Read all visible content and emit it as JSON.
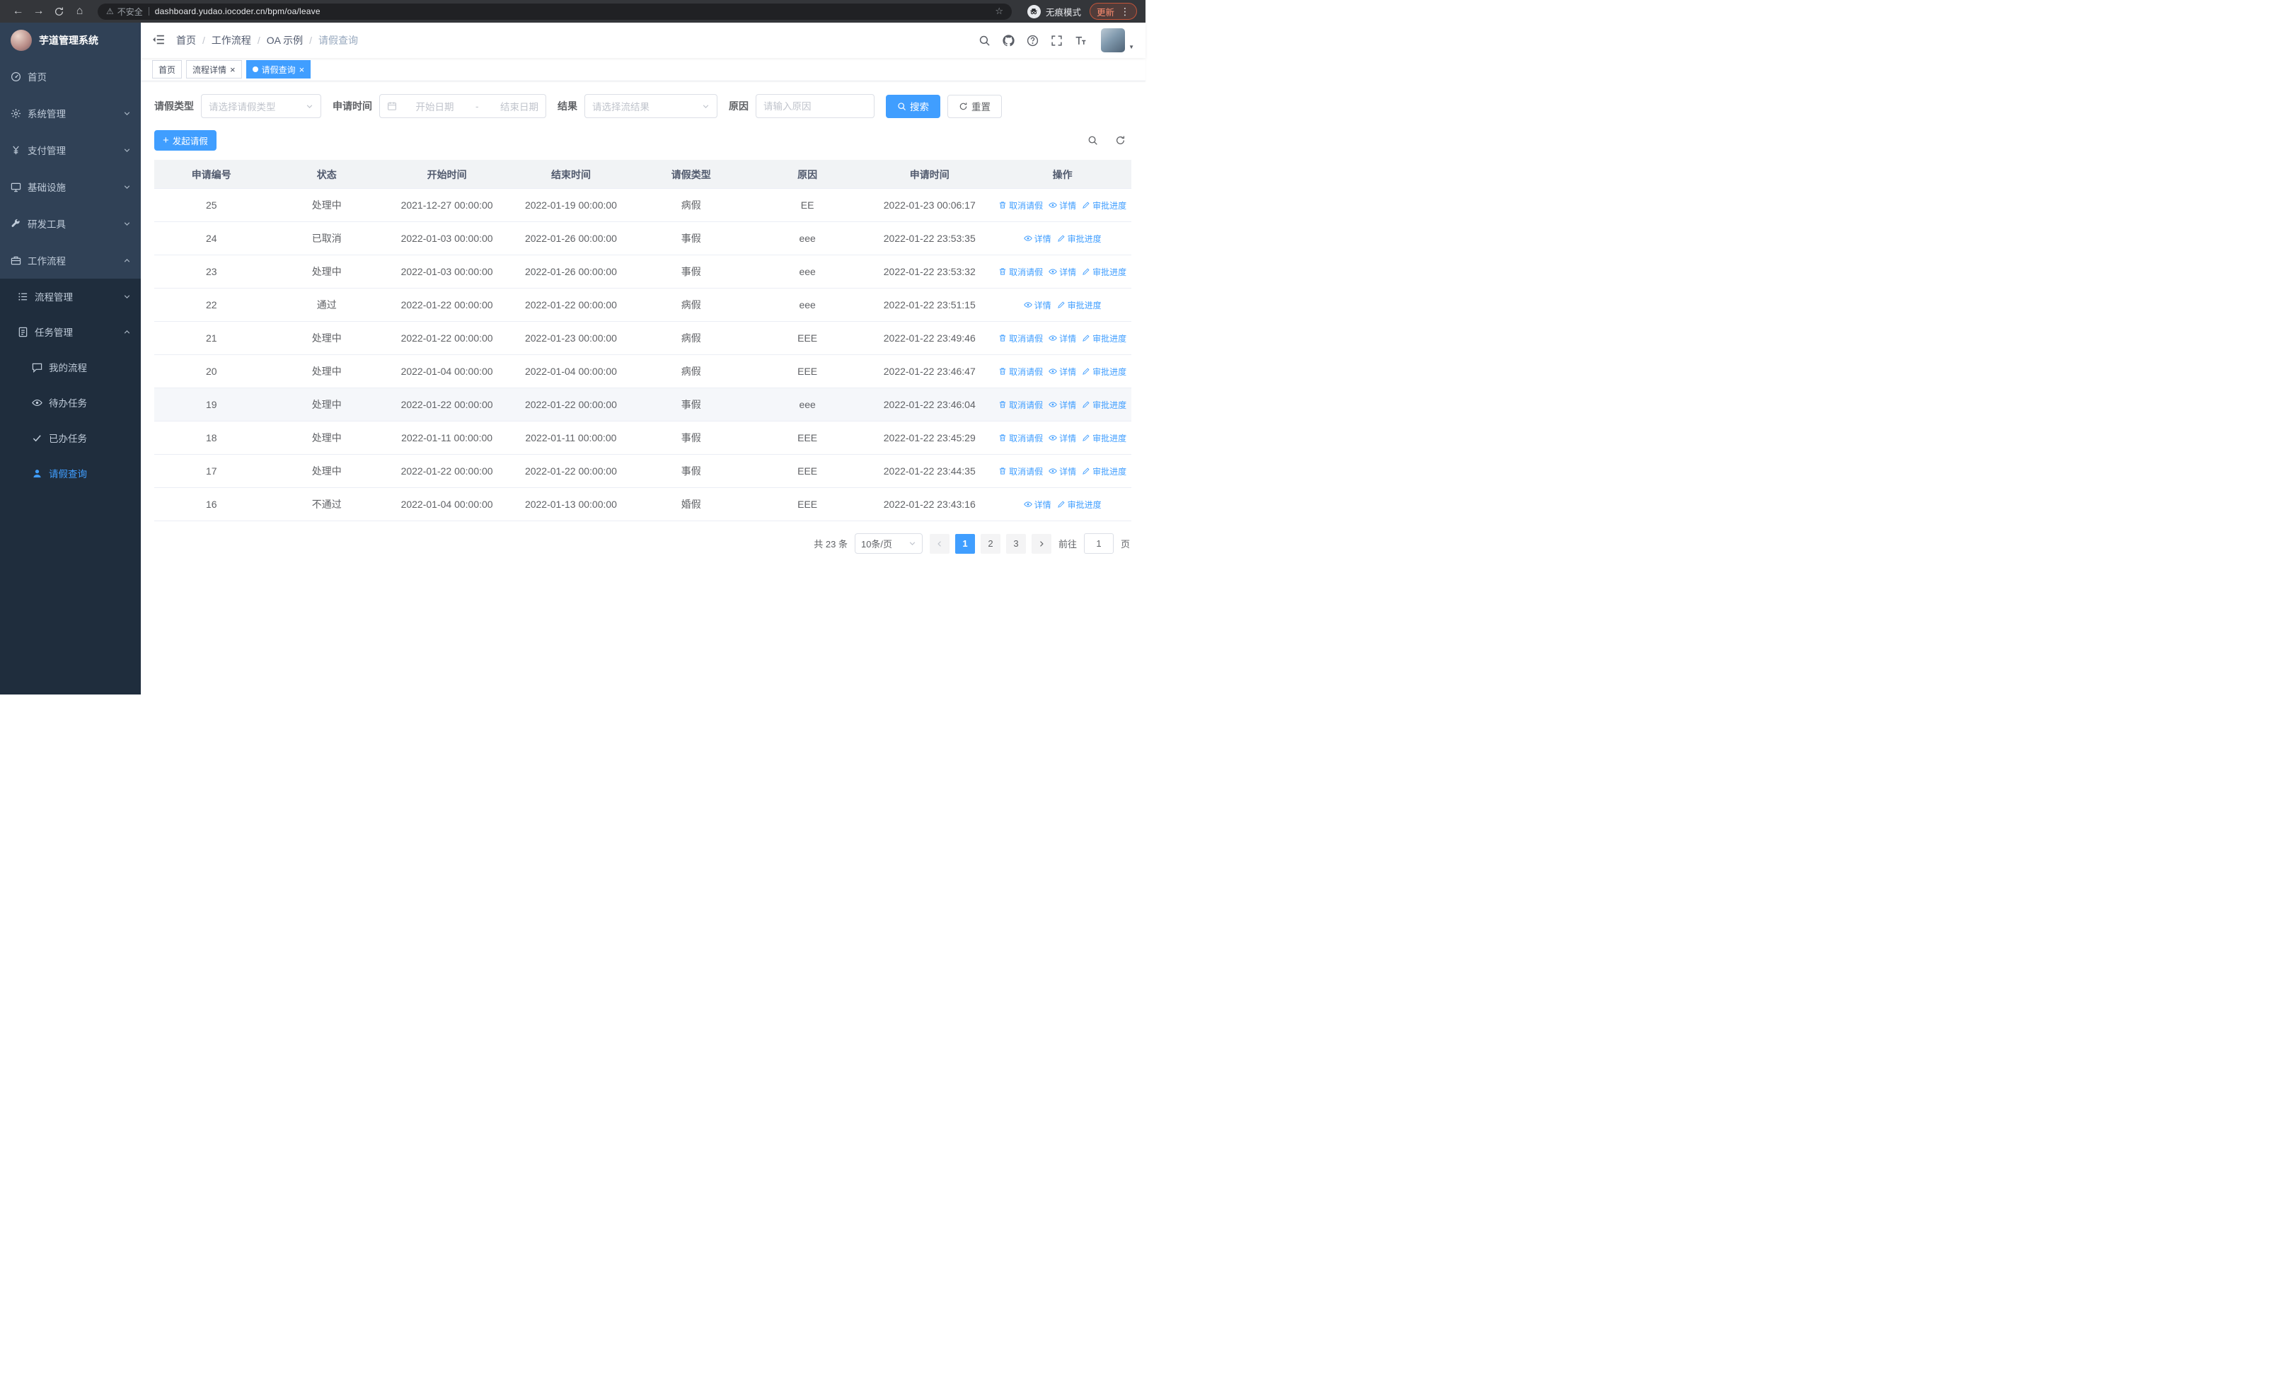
{
  "browser": {
    "url": "dashboard.yudao.iocoder.cn/bpm/oa/leave",
    "security_label": "不安全",
    "incognito_label": "无痕模式",
    "update_label": "更新",
    "nav_icons": [
      "back-icon",
      "forward-icon",
      "refresh-icon",
      "home-icon",
      "warning-icon",
      "bookmark-star-icon",
      "incognito-icon",
      "browser-menu-icon"
    ]
  },
  "sidebar": {
    "logo_title": "芋道管理系统",
    "menu": [
      {
        "id": "home",
        "label": "首页",
        "icon": "dashboard-icon",
        "level": 1
      },
      {
        "id": "system-mgmt",
        "label": "系统管理",
        "icon": "gear-icon",
        "level": 1,
        "arrow": "down"
      },
      {
        "id": "payment-mgmt",
        "label": "支付管理",
        "icon": "yen-icon",
        "level": 1,
        "arrow": "down"
      },
      {
        "id": "infrastructure",
        "label": "基础设施",
        "icon": "monitor-icon",
        "level": 1,
        "arrow": "down"
      },
      {
        "id": "dev-tools",
        "label": "研发工具",
        "icon": "tool-icon",
        "level": 1,
        "arrow": "down"
      },
      {
        "id": "workflow",
        "label": "工作流程",
        "icon": "briefcase-icon",
        "level": 1,
        "arrow": "up"
      },
      {
        "id": "process-mgmt",
        "label": "流程管理",
        "icon": "list-icon",
        "level": 2,
        "arrow": "down",
        "sub": true
      },
      {
        "id": "task-mgmt",
        "label": "任务管理",
        "icon": "task-icon",
        "level": 2,
        "arrow": "up",
        "sub": true
      },
      {
        "id": "my-process",
        "label": "我的流程",
        "icon": "chat-icon",
        "level": 3,
        "sub": true
      },
      {
        "id": "todo-task",
        "label": "待办任务",
        "icon": "eye-icon",
        "level": 3,
        "sub": true
      },
      {
        "id": "done-task",
        "label": "已办任务",
        "icon": "check-icon",
        "level": 3,
        "sub": true
      },
      {
        "id": "leave-query",
        "label": "请假查询",
        "icon": "user-icon",
        "level": 3,
        "sub": true,
        "active": true
      }
    ]
  },
  "header": {
    "breadcrumb": [
      "首页",
      "工作流程",
      "OA 示例",
      "请假查询"
    ],
    "nav_icons": [
      "search-icon",
      "github-icon",
      "help-icon",
      "fullscreen-icon",
      "font-size-icon",
      "avatar"
    ]
  },
  "tabs": [
    {
      "id": "home",
      "label": "首页",
      "closable": false,
      "active": false
    },
    {
      "id": "process-detail",
      "label": "流程详情",
      "closable": true,
      "active": false
    },
    {
      "id": "leave-query",
      "label": "请假查询",
      "closable": true,
      "active": true
    }
  ],
  "filters": {
    "leave_type_label": "请假类型",
    "leave_type_placeholder": "请选择请假类型",
    "apply_time_label": "申请时间",
    "start_date_placeholder": "开始日期",
    "range_separator": "-",
    "end_date_placeholder": "结束日期",
    "result_label": "结果",
    "result_placeholder": "请选择流结果",
    "reason_label": "原因",
    "reason_placeholder": "请输入原因",
    "search_label": "搜索",
    "reset_label": "重置"
  },
  "toolbar": {
    "create_label": "发起请假",
    "right_icons": [
      "search-toggle-icon",
      "refresh-table-icon"
    ]
  },
  "table": {
    "columns": [
      "申请编号",
      "状态",
      "开始时间",
      "结束时间",
      "请假类型",
      "原因",
      "申请时间",
      "操作"
    ],
    "action_defs": {
      "cancel": {
        "label": "取消请假",
        "icon": "trash-icon"
      },
      "detail": {
        "label": "详情",
        "icon": "eye-icon"
      },
      "progress": {
        "label": "审批进度",
        "icon": "edit-icon"
      }
    },
    "rows": [
      {
        "id": "25",
        "status": "处理中",
        "start": "2021-12-27 00:00:00",
        "end": "2022-01-19 00:00:00",
        "type": "病假",
        "reason": "EE",
        "apply_time": "2022-01-23 00:06:17",
        "actions": [
          "cancel",
          "detail",
          "progress"
        ]
      },
      {
        "id": "24",
        "status": "已取消",
        "start": "2022-01-03 00:00:00",
        "end": "2022-01-26 00:00:00",
        "type": "事假",
        "reason": "eee",
        "apply_time": "2022-01-22 23:53:35",
        "actions": [
          "detail",
          "progress"
        ]
      },
      {
        "id": "23",
        "status": "处理中",
        "start": "2022-01-03 00:00:00",
        "end": "2022-01-26 00:00:00",
        "type": "事假",
        "reason": "eee",
        "apply_time": "2022-01-22 23:53:32",
        "actions": [
          "cancel",
          "detail",
          "progress"
        ]
      },
      {
        "id": "22",
        "status": "通过",
        "start": "2022-01-22 00:00:00",
        "end": "2022-01-22 00:00:00",
        "type": "病假",
        "reason": "eee",
        "apply_time": "2022-01-22 23:51:15",
        "actions": [
          "detail",
          "progress"
        ]
      },
      {
        "id": "21",
        "status": "处理中",
        "start": "2022-01-22 00:00:00",
        "end": "2022-01-23 00:00:00",
        "type": "病假",
        "reason": "EEE",
        "apply_time": "2022-01-22 23:49:46",
        "actions": [
          "cancel",
          "detail",
          "progress"
        ]
      },
      {
        "id": "20",
        "status": "处理中",
        "start": "2022-01-04 00:00:00",
        "end": "2022-01-04 00:00:00",
        "type": "病假",
        "reason": "EEE",
        "apply_time": "2022-01-22 23:46:47",
        "actions": [
          "cancel",
          "detail",
          "progress"
        ]
      },
      {
        "id": "19",
        "status": "处理中",
        "start": "2022-01-22 00:00:00",
        "end": "2022-01-22 00:00:00",
        "type": "事假",
        "reason": "eee",
        "apply_time": "2022-01-22 23:46:04",
        "actions": [
          "cancel",
          "detail",
          "progress"
        ],
        "highlighted": true
      },
      {
        "id": "18",
        "status": "处理中",
        "start": "2022-01-11 00:00:00",
        "end": "2022-01-11 00:00:00",
        "type": "事假",
        "reason": "EEE",
        "apply_time": "2022-01-22 23:45:29",
        "actions": [
          "cancel",
          "detail",
          "progress"
        ]
      },
      {
        "id": "17",
        "status": "处理中",
        "start": "2022-01-22 00:00:00",
        "end": "2022-01-22 00:00:00",
        "type": "事假",
        "reason": "EEE",
        "apply_time": "2022-01-22 23:44:35",
        "actions": [
          "cancel",
          "detail",
          "progress"
        ]
      },
      {
        "id": "16",
        "status": "不通过",
        "start": "2022-01-04 00:00:00",
        "end": "2022-01-13 00:00:00",
        "type": "婚假",
        "reason": "EEE",
        "apply_time": "2022-01-22 23:43:16",
        "actions": [
          "detail",
          "progress"
        ]
      }
    ]
  },
  "pagination": {
    "total_label": "共 23 条",
    "page_size": "10条/页",
    "pages": [
      "1",
      "2",
      "3"
    ],
    "current_page": "1",
    "goto_label": "前往",
    "goto_value": "1",
    "page_suffix": "页"
  },
  "colors": {
    "accent": "#409EFF",
    "sidebar_bg": "#304156",
    "submenu_bg": "#1f2d3d"
  }
}
